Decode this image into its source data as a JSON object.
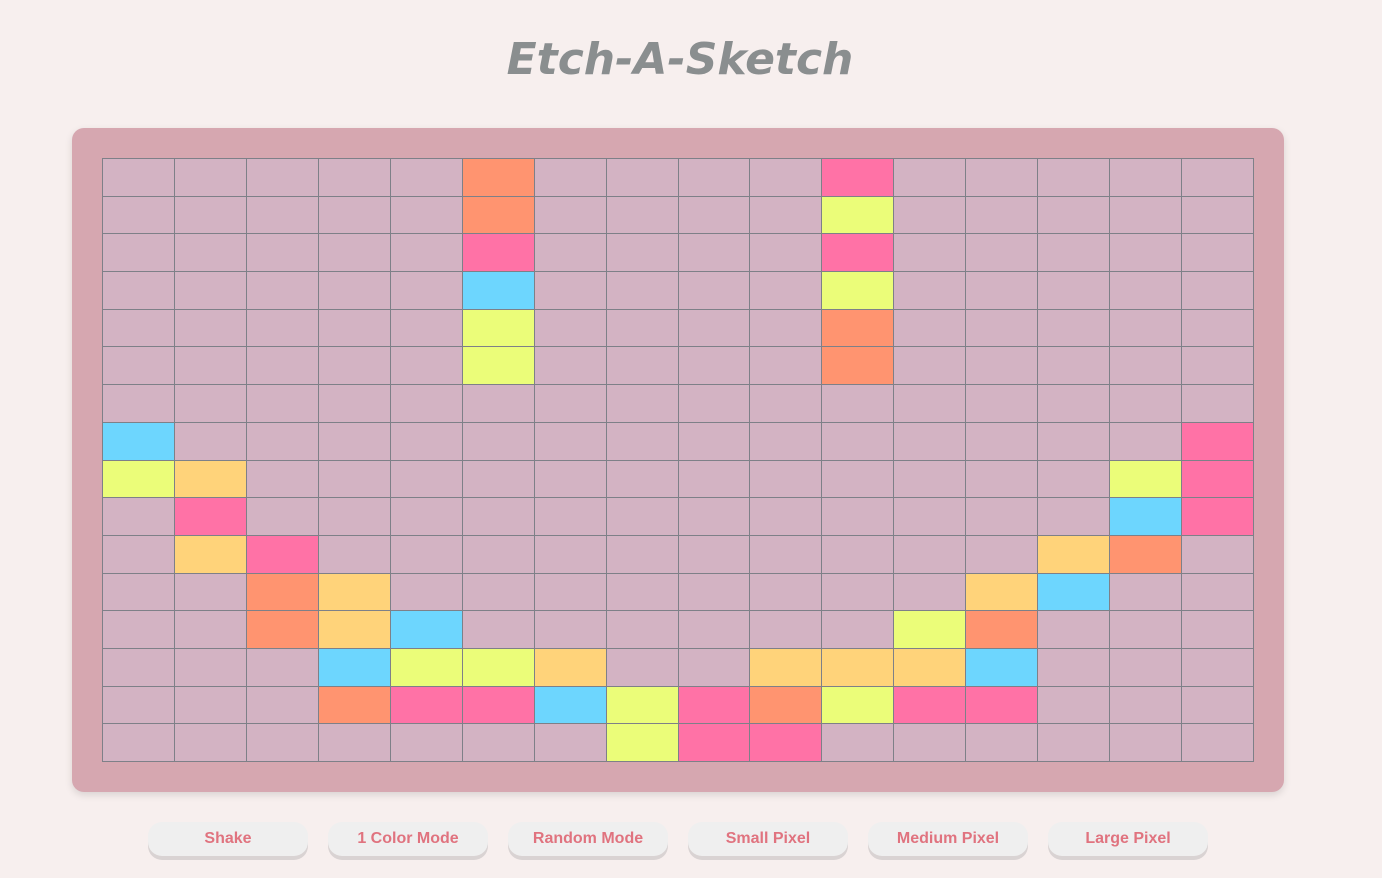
{
  "title": "Etch-A-Sketch",
  "colors": {
    "background": "#f7efee",
    "frame": "#d6a7b0",
    "empty_cell": "#d3b3c3",
    "grid_line": "#7e8088",
    "title_text": "#8a8e8f",
    "button_text": "#e0737f",
    "button_bg": "#efefef"
  },
  "grid": {
    "columns": 16,
    "rows": 16,
    "palette": {
      "O": "#ff9470",
      "P": "#ff72a6",
      "Y": "#ebfd79",
      "B": "#6dd6fe",
      "G": "#ffd37a",
      ".": "#d3b3c3"
    },
    "cells": [
      ".....O....P.....",
      ".....O....Y.....",
      ".....P....P.....",
      ".....B....Y.....",
      ".....Y....O.....",
      ".....Y....O.....",
      "................",
      "B..............P",
      "YG............YP",
      ".P............BP",
      ".GP..........GO.",
      "..OG........GB..",
      "..OGB......YO...",
      "...BYYG..GGGB...",
      "...OPPBYPOYPP...",
      ".......YPP......"
    ]
  },
  "buttons": [
    {
      "id": "shake",
      "label": "Shake"
    },
    {
      "id": "one-color",
      "label": "1 Color Mode"
    },
    {
      "id": "random",
      "label": "Random Mode"
    },
    {
      "id": "small",
      "label": "Small Pixel"
    },
    {
      "id": "medium",
      "label": "Medium Pixel"
    },
    {
      "id": "large",
      "label": "Large Pixel"
    }
  ]
}
